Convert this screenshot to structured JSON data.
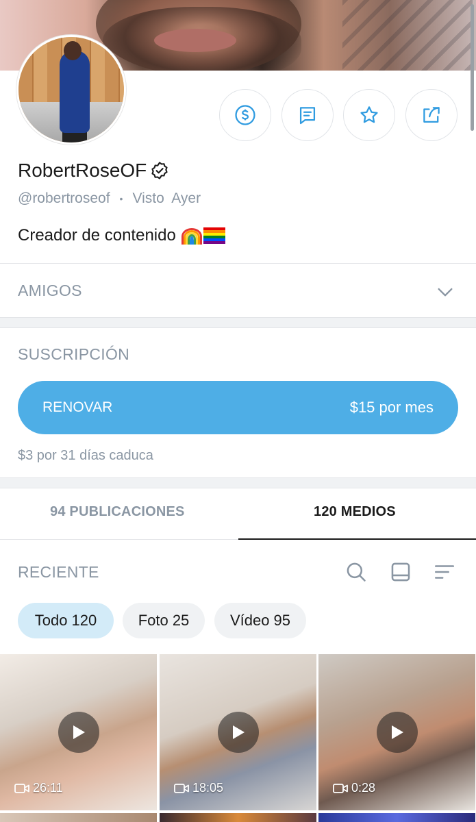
{
  "profile": {
    "display_name": "RobertRoseOF",
    "handle": "@robertroseof",
    "separator": "•",
    "last_seen": "Visto  Ayer",
    "bio": "Creador de contenido",
    "verified_icon": "verified-badge-icon"
  },
  "actions": {
    "tip_icon": "dollar-circle-icon",
    "message_icon": "message-icon",
    "favorite_icon": "star-icon",
    "share_icon": "share-icon"
  },
  "friends": {
    "title": "AMIGOS",
    "icon": "chevron-down-icon"
  },
  "subscription": {
    "title": "SUSCRIPCIÓN",
    "button_label": "RENOVAR",
    "button_price": "$15 por mes",
    "expire_note": "$3 por 31 días caduca"
  },
  "tabs": [
    {
      "label": "94 PUBLICACIONES",
      "active": false
    },
    {
      "label": "120 MEDIOS",
      "active": true
    }
  ],
  "media": {
    "sort_label": "RECIENTE",
    "tools": [
      "search-icon",
      "grid-view-icon",
      "sort-icon"
    ],
    "filters": [
      {
        "label": "Todo 120",
        "active": true
      },
      {
        "label": "Foto 25",
        "active": false
      },
      {
        "label": "Vídeo 95",
        "active": false
      }
    ],
    "items": [
      {
        "duration": "26:11"
      },
      {
        "duration": "18:05"
      },
      {
        "duration": "0:28"
      }
    ]
  },
  "colors": {
    "accent": "#4eaee6",
    "muted_text": "#8a96a3",
    "chip_active": "#d3ebf8"
  }
}
